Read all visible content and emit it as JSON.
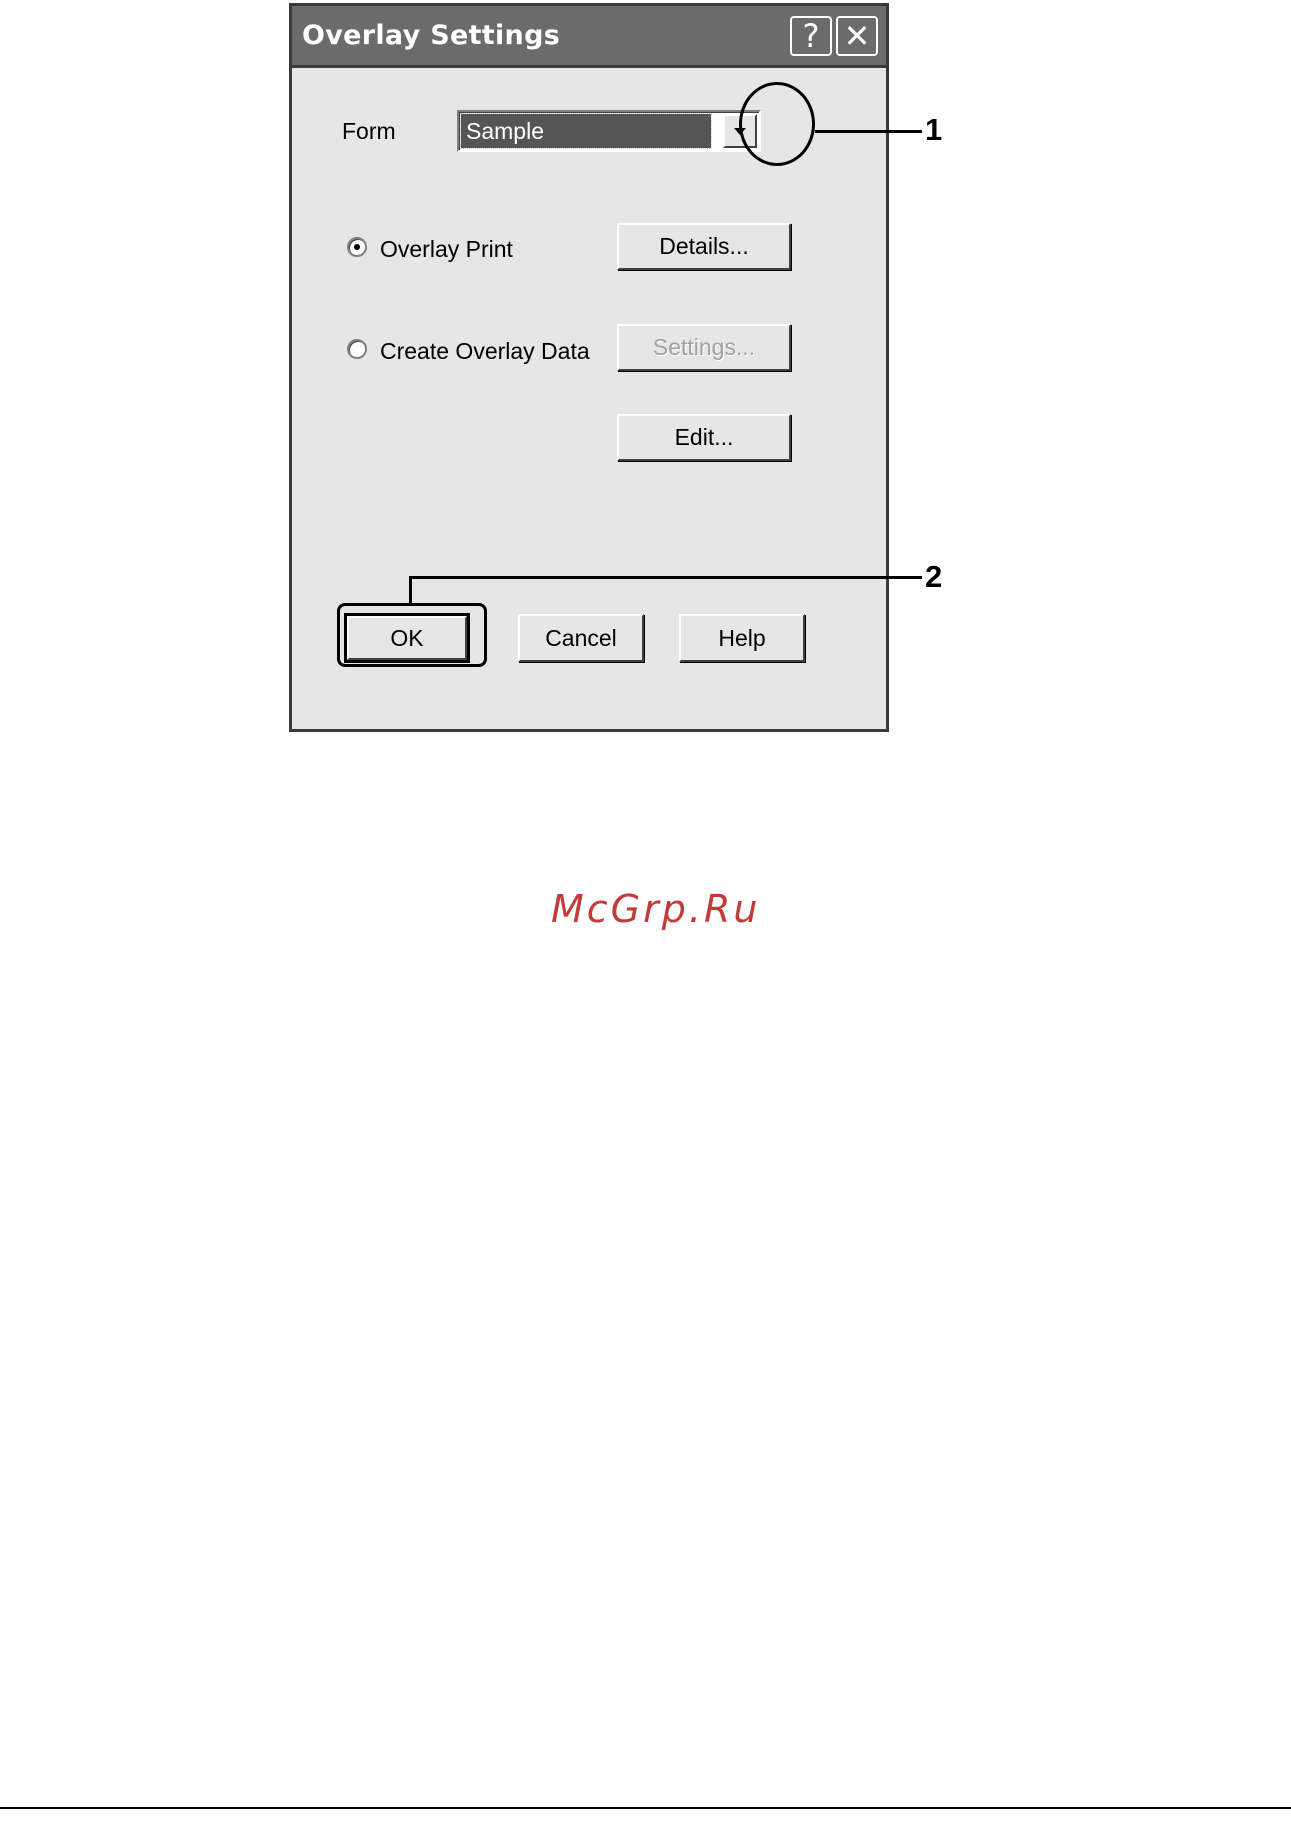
{
  "dialog": {
    "title": "Overlay Settings",
    "help_icon": "question-icon",
    "close_icon": "close-icon",
    "form_label": "Form",
    "form_value": "Sample",
    "overlay_print_label": "Overlay Print",
    "overlay_print_selected": true,
    "create_overlay_label": "Create Overlay Data",
    "create_overlay_selected": false,
    "details_label": "Details...",
    "settings_label": "Settings...",
    "settings_enabled": false,
    "edit_label": "Edit...",
    "ok_label": "OK",
    "cancel_label": "Cancel",
    "help_label": "Help"
  },
  "callouts": {
    "one": "1",
    "two": "2"
  },
  "watermark": "McGrp.Ru",
  "colors": {
    "dialog_bg": "#e6e6e6",
    "titlebar": "#6b6b6b",
    "selection": "#555555",
    "watermark": "#c33a3a"
  }
}
